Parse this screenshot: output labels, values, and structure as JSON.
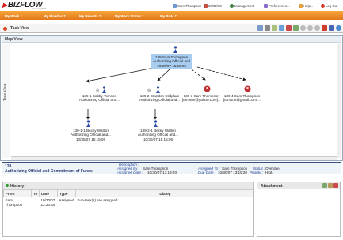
{
  "app": {
    "logo_text": "BIZFLOW",
    "logo_sub": "by HandySoft"
  },
  "topnav": {
    "user": "Sam Thompson",
    "date": "03/02/08",
    "management": "Management",
    "preferences": "Preferences...",
    "help": "Help...",
    "logout": "Log Out"
  },
  "menu": [
    "My Work",
    "My Flowbar",
    "My Reports",
    "My Work Status",
    "My BAM"
  ],
  "task": {
    "title": "Task View"
  },
  "map": {
    "title": "Map View",
    "tree_label": "Tree View",
    "root": {
      "lines": [
        "139 Sam Thompson",
        "Authorizing Official and",
        "10/30/07 15:15:06"
      ]
    },
    "nodes": [
      {
        "lines": [
          "139-1 Bobby Tomson",
          "Authorizing Official and..."
        ]
      },
      {
        "lines": [
          "139-2 Brandon Stidplam",
          "Authorizing Official and..."
        ]
      },
      {
        "lines": [
          "139-3 Sam Thompson",
          "[tomson@yahoo.com]..."
        ]
      },
      {
        "lines": [
          "139-4 Sam Thompson",
          "[tomson@gmail.com]..."
        ]
      },
      {
        "lines": [
          "139-1-1 Becky Walton",
          "Authorizing Official and...",
          "10/30/07 15:15:06"
        ]
      },
      {
        "lines": [
          "139-2-1 Becky Walton",
          "Authorizing Official and...",
          "10/30/07 15:15:06"
        ]
      }
    ]
  },
  "info": {
    "id": "139",
    "name": "Authorizing Official and Commitment of Funds",
    "description_label": "Description :",
    "assigned_by_label": "Assigned By :",
    "assigned_by": "Sam Thompson",
    "assigned_to_label": "Assigned To :",
    "assigned_to": "Sam Thompson",
    "status_label": "Status :",
    "status": "Overdue",
    "assigned_date_label": "Assigned Date :",
    "assigned_date": "10/30/07 13:19:20",
    "due_date_label": "Due Date :",
    "due_date": "10/30/07 13:19:20",
    "priority_label": "Priority :",
    "priority": "High"
  },
  "history": {
    "title": "History",
    "columns": [
      "From",
      "To",
      "Date",
      "Type",
      "Dialog"
    ],
    "rows": [
      {
        "from": "Sam Thompson",
        "to": "",
        "date": "10/30/07 13:20:34",
        "type": "Assigned",
        "dialog": "Sub-task(s) are assigned"
      }
    ]
  },
  "attachment": {
    "title": "Attachment"
  },
  "colors": {
    "accent": "#e8861f",
    "root_node": "#a9cdf1",
    "info_bar": "#38507a"
  }
}
